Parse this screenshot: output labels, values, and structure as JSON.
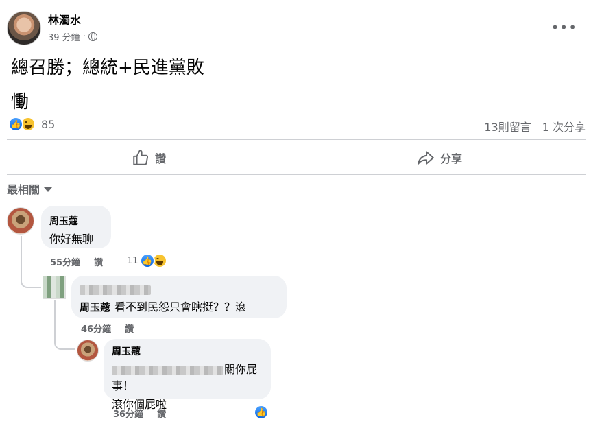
{
  "post": {
    "author": "林濁水",
    "time": "39 分鐘",
    "visibility_icon": "globe-icon",
    "more_icon": "more-icon",
    "more_label": "•••",
    "text_line1": "總召勝；總統+民進黨敗",
    "text_line2": "慟",
    "reaction_count": "85",
    "comments_count": "13則留言",
    "shares_count": "1 次分享"
  },
  "actions": {
    "like_label": "讚",
    "share_label": "分享"
  },
  "comments_sort": {
    "label": "最相關"
  },
  "comments": [
    {
      "author": "周玉蔻",
      "text": "你好無聊",
      "time": "55分鐘",
      "like_label": "讚",
      "reaction_count": "11"
    },
    {
      "author": "",
      "mention": "周玉蔻",
      "text": "看不到民怨只會瞎挺？？滾",
      "time": "46分鐘",
      "like_label": "讚"
    },
    {
      "author": "周玉蔻",
      "text_line1": "關你屁事！",
      "text_line2": "滾你個屁啦",
      "time": "36分鐘",
      "like_label": "讚"
    }
  ],
  "colors": {
    "like_blue": "#0a66e0",
    "muted_text": "#65676b",
    "bubble_bg": "#f0f2f5"
  }
}
